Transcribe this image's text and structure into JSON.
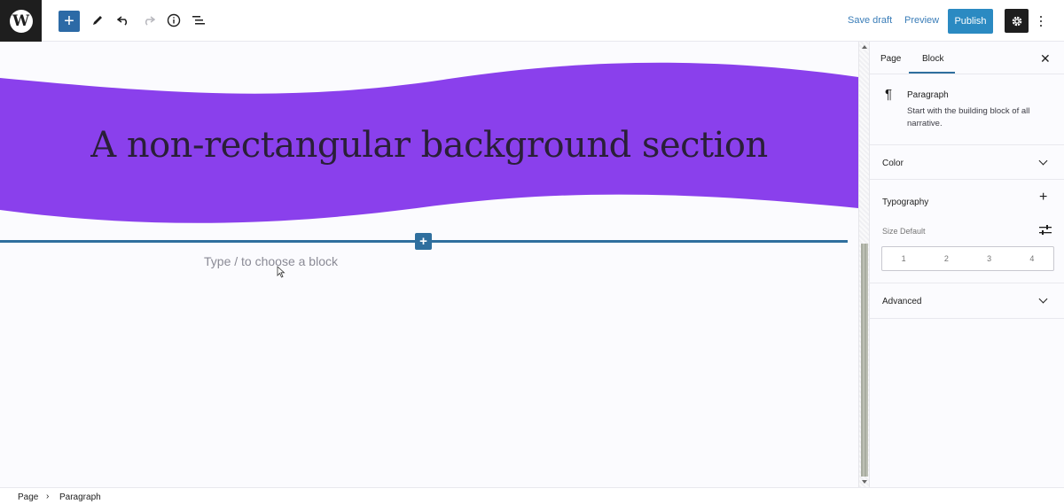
{
  "toolbar": {
    "save_draft": "Save draft",
    "preview": "Preview",
    "publish": "Publish"
  },
  "editor": {
    "heading": "A non-rectangular background section",
    "placeholder": "Type / to choose a block",
    "band_color": "#8a40ec"
  },
  "sidebar": {
    "tabs": [
      "Page",
      "Block"
    ],
    "active_tab": "Block",
    "block": {
      "icon": "¶",
      "title": "Paragraph",
      "description": "Start with the building block of all narrative."
    },
    "panels": {
      "color": "Color",
      "typography": "Typography",
      "advanced": "Advanced"
    },
    "size": {
      "label": "Size",
      "value": "Default",
      "options": [
        "1",
        "2",
        "3",
        "4"
      ]
    }
  },
  "breadcrumb": {
    "items": [
      "Page",
      "Paragraph"
    ]
  },
  "colors": {
    "accent": "#2f6f9e",
    "publish": "#2b8ac2"
  }
}
